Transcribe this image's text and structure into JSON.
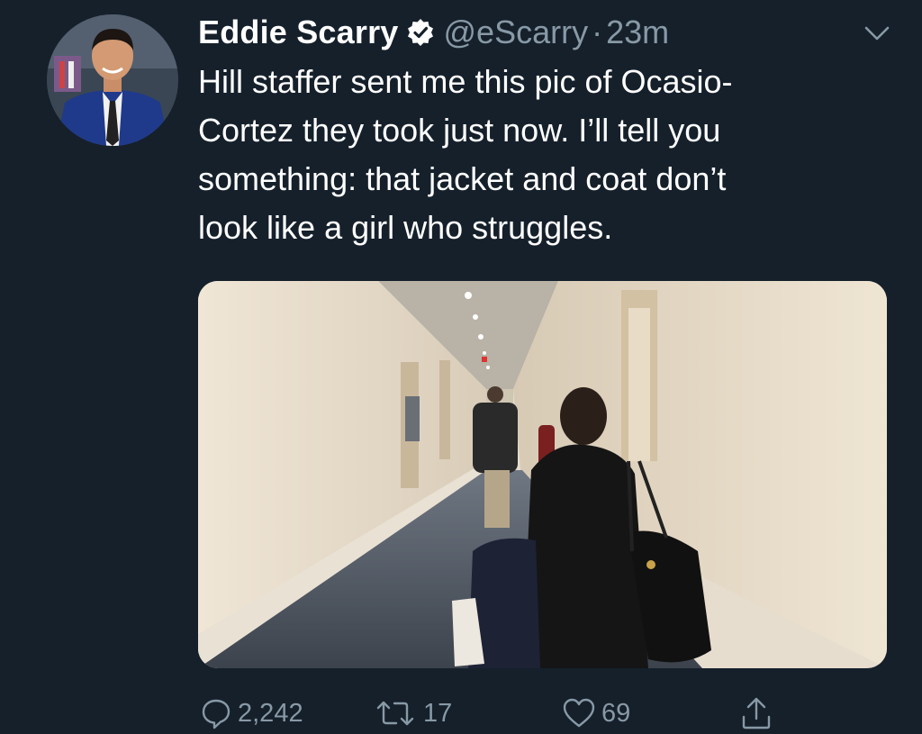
{
  "tweet": {
    "display_name": "Eddie Scarry",
    "handle": "@eScarry",
    "separator": "·",
    "timestamp": "23m",
    "text": "Hill staffer sent me this pic of Ocasio-\nCortez they took just now. I’ll tell you\nsomething: that jacket and coat don’t\nlook like a girl who struggles."
  },
  "actions": {
    "reply_count": "2,242",
    "retweet_count": "17",
    "like_count": "69"
  },
  "icons": {
    "verified": "verified-badge-icon",
    "caret": "chevron-down-icon",
    "reply": "reply-bubble-icon",
    "retweet": "retweet-arrows-icon",
    "like": "heart-icon",
    "share": "share-up-arrow-icon"
  },
  "colors": {
    "background": "#15202b",
    "text_primary": "#ffffff",
    "text_secondary": "#8899a6"
  }
}
